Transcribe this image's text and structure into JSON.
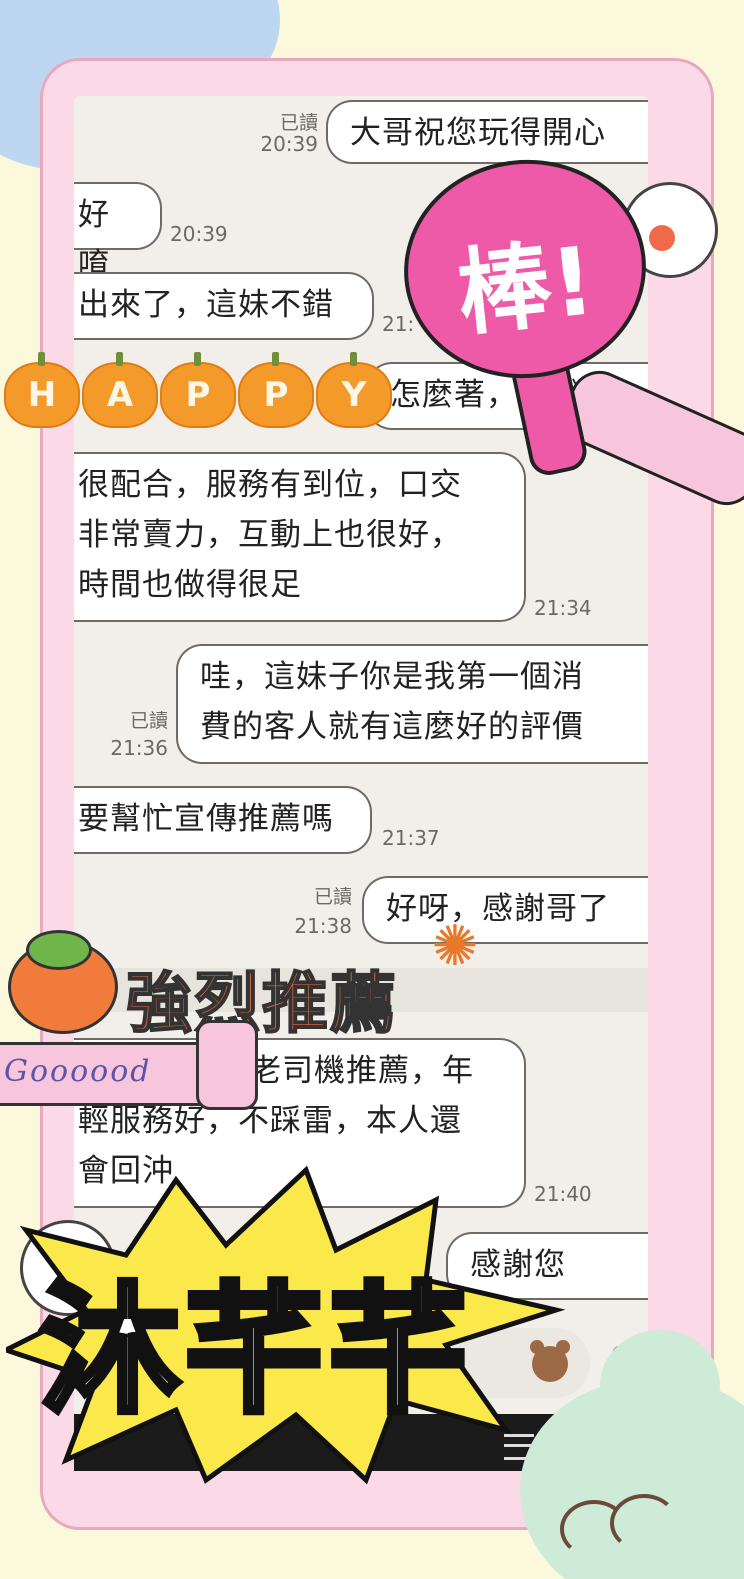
{
  "messages": [
    {
      "side": "right",
      "read": "已讀",
      "time": "20:39",
      "text": "大哥祝您玩得開心"
    },
    {
      "side": "left",
      "time": "20:39",
      "text": "好唷"
    },
    {
      "side": "left",
      "time": "21:",
      "text": "出來了，這妹不錯"
    },
    {
      "side": "right",
      "read": "",
      "time": "",
      "text": "怎麼著，說說看"
    },
    {
      "side": "left",
      "time": "21:34",
      "lines": [
        "很配合，服務有到位，口交",
        "非常賣力，互動上也很好，",
        "時間也做得很足"
      ]
    },
    {
      "side": "right",
      "read": "已讀",
      "time": "21:36",
      "lines": [
        "哇，這妹子你是我第一個消",
        "費的客人就有這麼好的評價"
      ]
    },
    {
      "side": "left",
      "time": "21:37",
      "text": "要幫忙宣傳推薦嗎"
    },
    {
      "side": "right",
      "read": "已讀",
      "time": "21:38",
      "text": "好呀，感謝哥了"
    },
    {
      "side": "left",
      "time": "21:40",
      "lines": [
        "老司機推薦，年",
        "輕服務好，不踩雷，本人還",
        "會回沖"
      ]
    },
    {
      "side": "right",
      "read": "",
      "time": "",
      "text": "感謝您唷！"
    }
  ],
  "stickers": {
    "bang": "棒!",
    "happy": [
      "H",
      "A",
      "P",
      "P",
      "Y"
    ],
    "recommend": "強烈推薦",
    "good": "Goooood",
    "name": "沐芊芊"
  },
  "icons": {
    "sticker_button": "bear-sticker-icon",
    "voice_button": "microphone-icon",
    "menu": "menu-icon"
  },
  "colors": {
    "background": "#fbf8dc",
    "frame": "#fbd9e6",
    "chat_bg": "#f2efea",
    "bang": "#ef5aa8",
    "pumpkin": "#f39a2b",
    "recommend": "#e86b4a"
  }
}
